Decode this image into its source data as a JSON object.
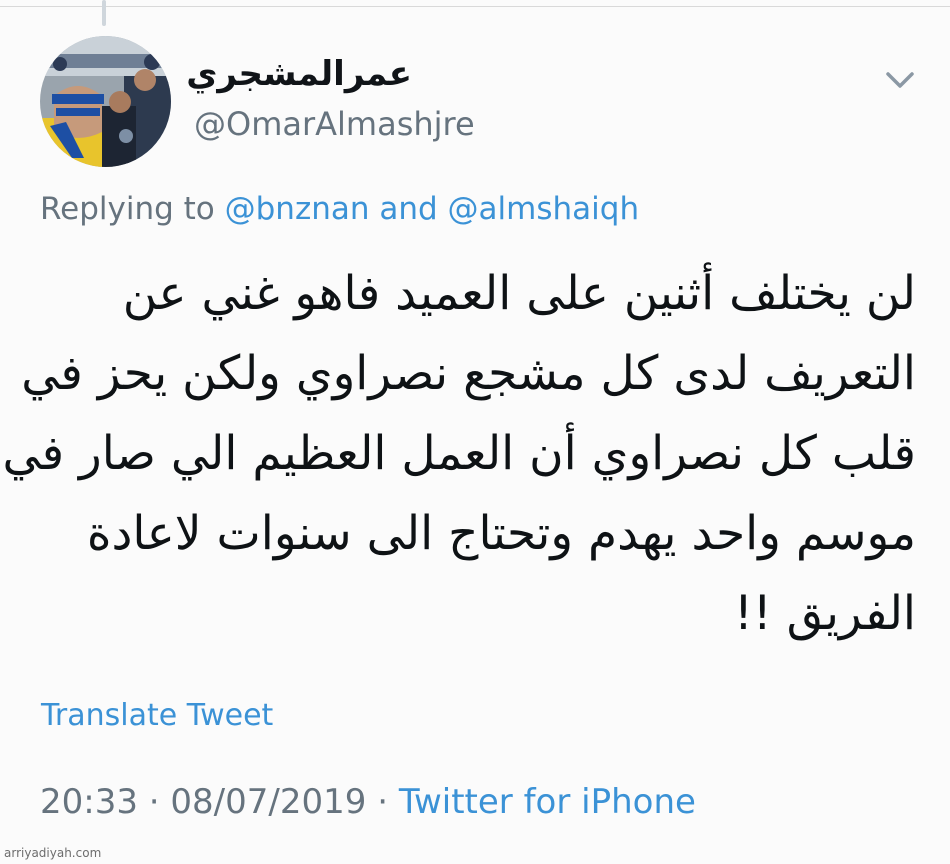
{
  "tweet": {
    "display_name": "عمرالمشجري",
    "handle": "@OmarAlmashjre",
    "replying": {
      "prefix": "Replying to ",
      "mention1": "@bnznan",
      "connector": " and ",
      "mention2": "@almshaiqh"
    },
    "body_lines": [
      "لن يختلف أثنين على العميد فاهو غني عن",
      "التعريف لدى كل مشجع نصراوي ولكن يحز في",
      "قلب كل نصراوي أن العمل العظيم الي صار في",
      "موسم واحد يهدم وتحتاج الى سنوات لاعادة",
      "الفريق !!"
    ],
    "translate_label": "Translate Tweet",
    "time": "20:33",
    "separator1": " · ",
    "date": "08/07/2019",
    "separator2": " · ",
    "source": "Twitter for iPhone"
  },
  "watermark": "arriyadiyah.com",
  "icons": {
    "menu": "chevron-down-icon",
    "avatar": "profile-photo"
  },
  "colors": {
    "link": "#3b92d6",
    "secondary_text": "#66737e",
    "primary_text": "#0e1215",
    "background": "#fbfbfb"
  }
}
